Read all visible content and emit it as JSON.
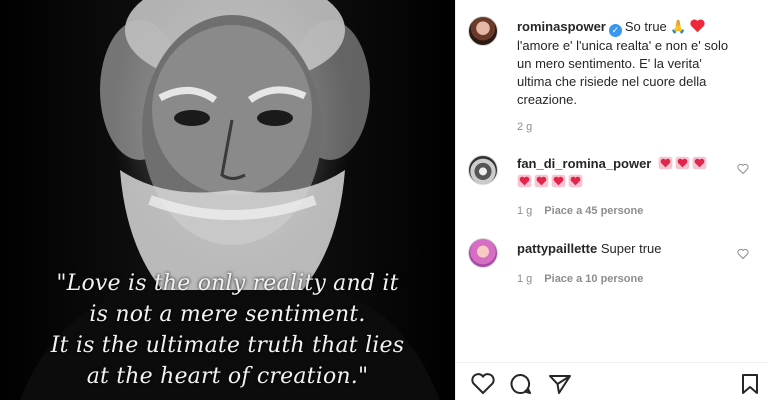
{
  "image": {
    "quote_lines": [
      "\"Love is the only reality and it",
      "is not a mere sentiment.",
      "It is the ultimate truth that lies",
      "at the heart of creation.\""
    ]
  },
  "post": {
    "username": "rominaspower",
    "caption_lead": "So true 🙏",
    "caption_lines": [
      "l'amore e' l'unica realta' e non e' solo",
      "un mero sentimento. E' la verita'",
      "ultima che risiede nel cuore della",
      "creazione."
    ],
    "age": "2 g"
  },
  "comments": [
    {
      "username": "fan_di_romina_power",
      "age": "1 g",
      "likes": "Piace a 45 persone",
      "hearts_line1": 3,
      "hearts_line2": 4
    },
    {
      "username": "pattypaillette",
      "text": "Super true",
      "age": "1 g",
      "likes": "Piace a 10 persone"
    }
  ],
  "icons": {
    "verified": "verified-badge-icon",
    "like": "heart-outline-icon",
    "comment": "comment-bubble-icon",
    "share": "paper-plane-icon",
    "save": "bookmark-icon"
  },
  "colors": {
    "verified": "#3897f0",
    "heart_emoji": "#ed2a3a",
    "meta": "#8e8e8e"
  }
}
